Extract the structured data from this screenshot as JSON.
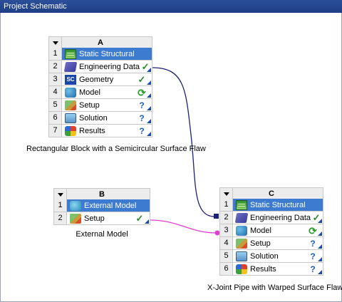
{
  "window": {
    "title": "Project Schematic"
  },
  "systems": [
    {
      "letter": "A",
      "caption": "Rectangular Block with a Semicircular Surface Flaw",
      "rows": [
        {
          "num": "1",
          "label": "Static Structural",
          "icon": "static-structural-icon",
          "state": ""
        },
        {
          "num": "2",
          "label": "Engineering Data",
          "icon": "engineering-data-icon",
          "state": "check"
        },
        {
          "num": "3",
          "label": "Geometry",
          "icon": "geometry-icon",
          "state": "check"
        },
        {
          "num": "4",
          "label": "Model",
          "icon": "model-icon",
          "state": "refresh"
        },
        {
          "num": "5",
          "label": "Setup",
          "icon": "setup-icon",
          "state": "question"
        },
        {
          "num": "6",
          "label": "Solution",
          "icon": "solution-icon",
          "state": "question"
        },
        {
          "num": "7",
          "label": "Results",
          "icon": "results-icon",
          "state": "question"
        }
      ]
    },
    {
      "letter": "B",
      "caption": "External Model",
      "rows": [
        {
          "num": "1",
          "label": "External Model",
          "icon": "external-model-icon",
          "state": ""
        },
        {
          "num": "2",
          "label": "Setup",
          "icon": "setup-icon",
          "state": "check"
        }
      ]
    },
    {
      "letter": "C",
      "caption": "X-Joint Pipe with Warped Surface Flaw",
      "rows": [
        {
          "num": "1",
          "label": "Static Structural",
          "icon": "static-structural-icon",
          "state": ""
        },
        {
          "num": "2",
          "label": "Engineering Data",
          "icon": "engineering-data-icon",
          "state": "check"
        },
        {
          "num": "3",
          "label": "Model",
          "icon": "model-icon",
          "state": "refresh"
        },
        {
          "num": "4",
          "label": "Setup",
          "icon": "setup-icon",
          "state": "question"
        },
        {
          "num": "5",
          "label": "Solution",
          "icon": "solution-icon",
          "state": "question"
        },
        {
          "num": "6",
          "label": "Results",
          "icon": "results-icon",
          "state": "question"
        }
      ]
    }
  ],
  "icons": {
    "sc_text": "SC",
    "check": "✓",
    "refresh": "⟳",
    "question": "?"
  },
  "colors": {
    "title_row": "#3d7bd1",
    "shared_link": "#1f1f7a",
    "transfer_link": "#e040d0"
  }
}
